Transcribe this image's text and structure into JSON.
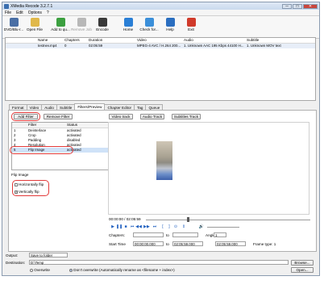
{
  "window": {
    "title": "XMedia Recode 3.2.7.1",
    "minimize": "─",
    "maximize": "□",
    "close": "✕"
  },
  "menu": [
    "File",
    "Edit",
    "Options",
    "?"
  ],
  "toolbar": [
    {
      "label": "DVD/Blu-r...",
      "icon": "disc-icon",
      "color": "#4a6fa5",
      "disabled": false
    },
    {
      "label": "Open File",
      "icon": "open-file-icon",
      "color": "#e0b84a",
      "disabled": false
    },
    {
      "label": "Add to qu...",
      "icon": "add-queue-icon",
      "color": "#3ca040",
      "disabled": false
    },
    {
      "label": "Remove Job",
      "icon": "remove-job-icon",
      "color": "#b8b8b8",
      "disabled": true
    },
    {
      "label": "Encode",
      "icon": "encode-icon",
      "color": "#3a3a3a",
      "disabled": false
    },
    {
      "label": "Home",
      "icon": "home-icon",
      "color": "#2a7fd6",
      "disabled": false
    },
    {
      "label": "Check for...",
      "icon": "refresh-icon",
      "color": "#3b8fd9",
      "disabled": false
    },
    {
      "label": "Help",
      "icon": "help-icon",
      "color": "#2a6ec0",
      "disabled": false
    },
    {
      "label": "Exit",
      "icon": "exit-icon",
      "color": "#d03a2a",
      "disabled": false
    }
  ],
  "filelist": {
    "columns": [
      "Name",
      "Chapters",
      "Duration",
      "Video",
      "Audio",
      "Subtitle"
    ],
    "rows": [
      {
        "name": "testnev.mp4",
        "chapters": "0",
        "duration": "02:05:59",
        "video": "MPEG-4 AVC / H.264 200...",
        "audio": "1. Unknown AAC 195 Kbps 44100 H...",
        "subtitle": "1. Unknown MOV text"
      }
    ]
  },
  "tabs": [
    "Format",
    "Video",
    "Audio",
    "Subtitle",
    "Filters/Preview",
    "Chapter Editor",
    "Tag",
    "Queue"
  ],
  "active_tab": "Filters/Preview",
  "filters_panel": {
    "add_filter": "Add Filter",
    "remove_filter": "Remove Filter",
    "columns": [
      "Filter",
      "Status"
    ],
    "rows": [
      {
        "num": "1",
        "filter": "Deinterlace",
        "status": "activated"
      },
      {
        "num": "2",
        "filter": "Crop",
        "status": "activated"
      },
      {
        "num": "3",
        "filter": "Padding",
        "status": "disabled"
      },
      {
        "num": "4",
        "filter": "Resolution",
        "status": "activated"
      },
      {
        "num": "5",
        "filter": "Flip Image",
        "status": "activated"
      }
    ],
    "selected_row": "5"
  },
  "flip_image": {
    "title": "Flip Image",
    "horizontal": "Horizontally flip",
    "vertical": "Vertically flip",
    "horizontal_checked": false,
    "vertical_checked": true
  },
  "preview_tracks": [
    "Video track",
    "Audio Track",
    "Subtitles Track"
  ],
  "player": {
    "time": "00:00:00 / 02:05:59",
    "chapters_label": "Chapters:",
    "to_label": "to",
    "angle_label": "Angle",
    "angle_value": "1",
    "start_time_label": "Start Time",
    "start_time": "00:00:00.000",
    "end_time_label": "to",
    "end_time": "02:05:59.000",
    "duration": "02:05:59.000",
    "frame_type": "Frame type: 1"
  },
  "output": {
    "output_label": "Output:",
    "output_value": "Save to folder",
    "destination_label": "Destination:",
    "destination_value": "D:\\Temp",
    "browse": "Browse...",
    "overwrite": "Overwrite",
    "dont_overwrite": "Don't overwrite (Automatically rename as <filename + index>)",
    "open": "Open..."
  },
  "colors": {
    "highlight": "#e23a3a",
    "selection": "#cfe2f8",
    "accent": "#1f5fbf"
  }
}
